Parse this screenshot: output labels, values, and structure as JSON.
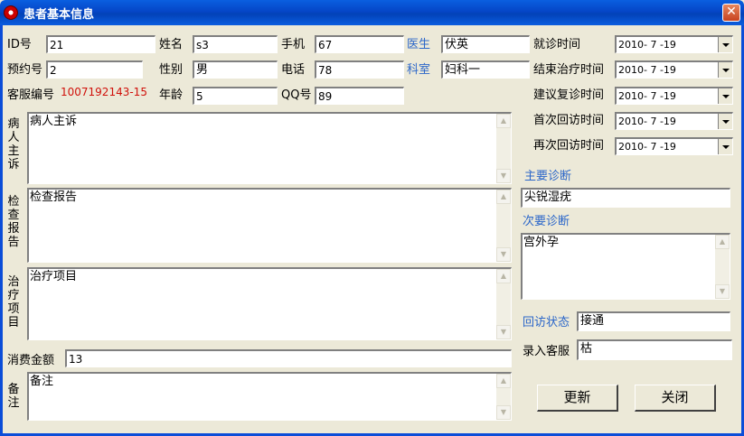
{
  "window": {
    "title": "患者基本信息",
    "close": "✕"
  },
  "fields": {
    "id": {
      "label": "ID号",
      "value": "21"
    },
    "name": {
      "label": "姓名",
      "value": "s3"
    },
    "mobile": {
      "label": "手机",
      "value": "67"
    },
    "doctor": {
      "label": "医生",
      "value": "伏英"
    },
    "appointment": {
      "label": "预约号",
      "value": "2"
    },
    "gender": {
      "label": "性别",
      "value": "男"
    },
    "phone": {
      "label": "电话",
      "value": "78"
    },
    "department": {
      "label": "科室",
      "value": "妇科一"
    },
    "service_code": {
      "label": "客服编号",
      "value": "1007192143-15"
    },
    "age": {
      "label": "年龄",
      "value": "5"
    },
    "qq": {
      "label": "QQ号",
      "value": "89"
    },
    "amount": {
      "label": "消费金额",
      "value": "13"
    }
  },
  "dates": {
    "visit": {
      "label": "就诊时间",
      "value": "2010- 7 -19"
    },
    "end_treatment": {
      "label": "结束治疗时间",
      "value": "2010- 7 -19"
    },
    "suggest_revisit": {
      "label": "建议复诊时间",
      "value": "2010- 7 -19"
    },
    "first_followup": {
      "label": "首次回访时间",
      "value": "2010- 7 -19"
    },
    "second_followup": {
      "label": "再次回访时间",
      "value": "2010- 7 -19"
    }
  },
  "memos": {
    "complaint": {
      "label": "病人主诉",
      "value": "病人主诉"
    },
    "report": {
      "label": "检查报告",
      "value": "检查报告"
    },
    "treatment": {
      "label": "治疗项目",
      "value": "治疗项目"
    },
    "remark": {
      "label": "备注",
      "value": "备注"
    }
  },
  "diagnosis": {
    "main_label": "主要诊断",
    "main_value": "尖锐湿疣",
    "secondary_label": "次要诊断",
    "secondary_value": "宫外孕"
  },
  "followup": {
    "status_label": "回访状态",
    "status_value": "接通",
    "staff_label": "录入客服",
    "staff_value": "枯"
  },
  "buttons": {
    "update": "更新",
    "close": "关闭"
  },
  "colors": {
    "titlebar": "#0A5FE0",
    "accent_label": "#2B66C9",
    "service_code": "#D0100A"
  }
}
